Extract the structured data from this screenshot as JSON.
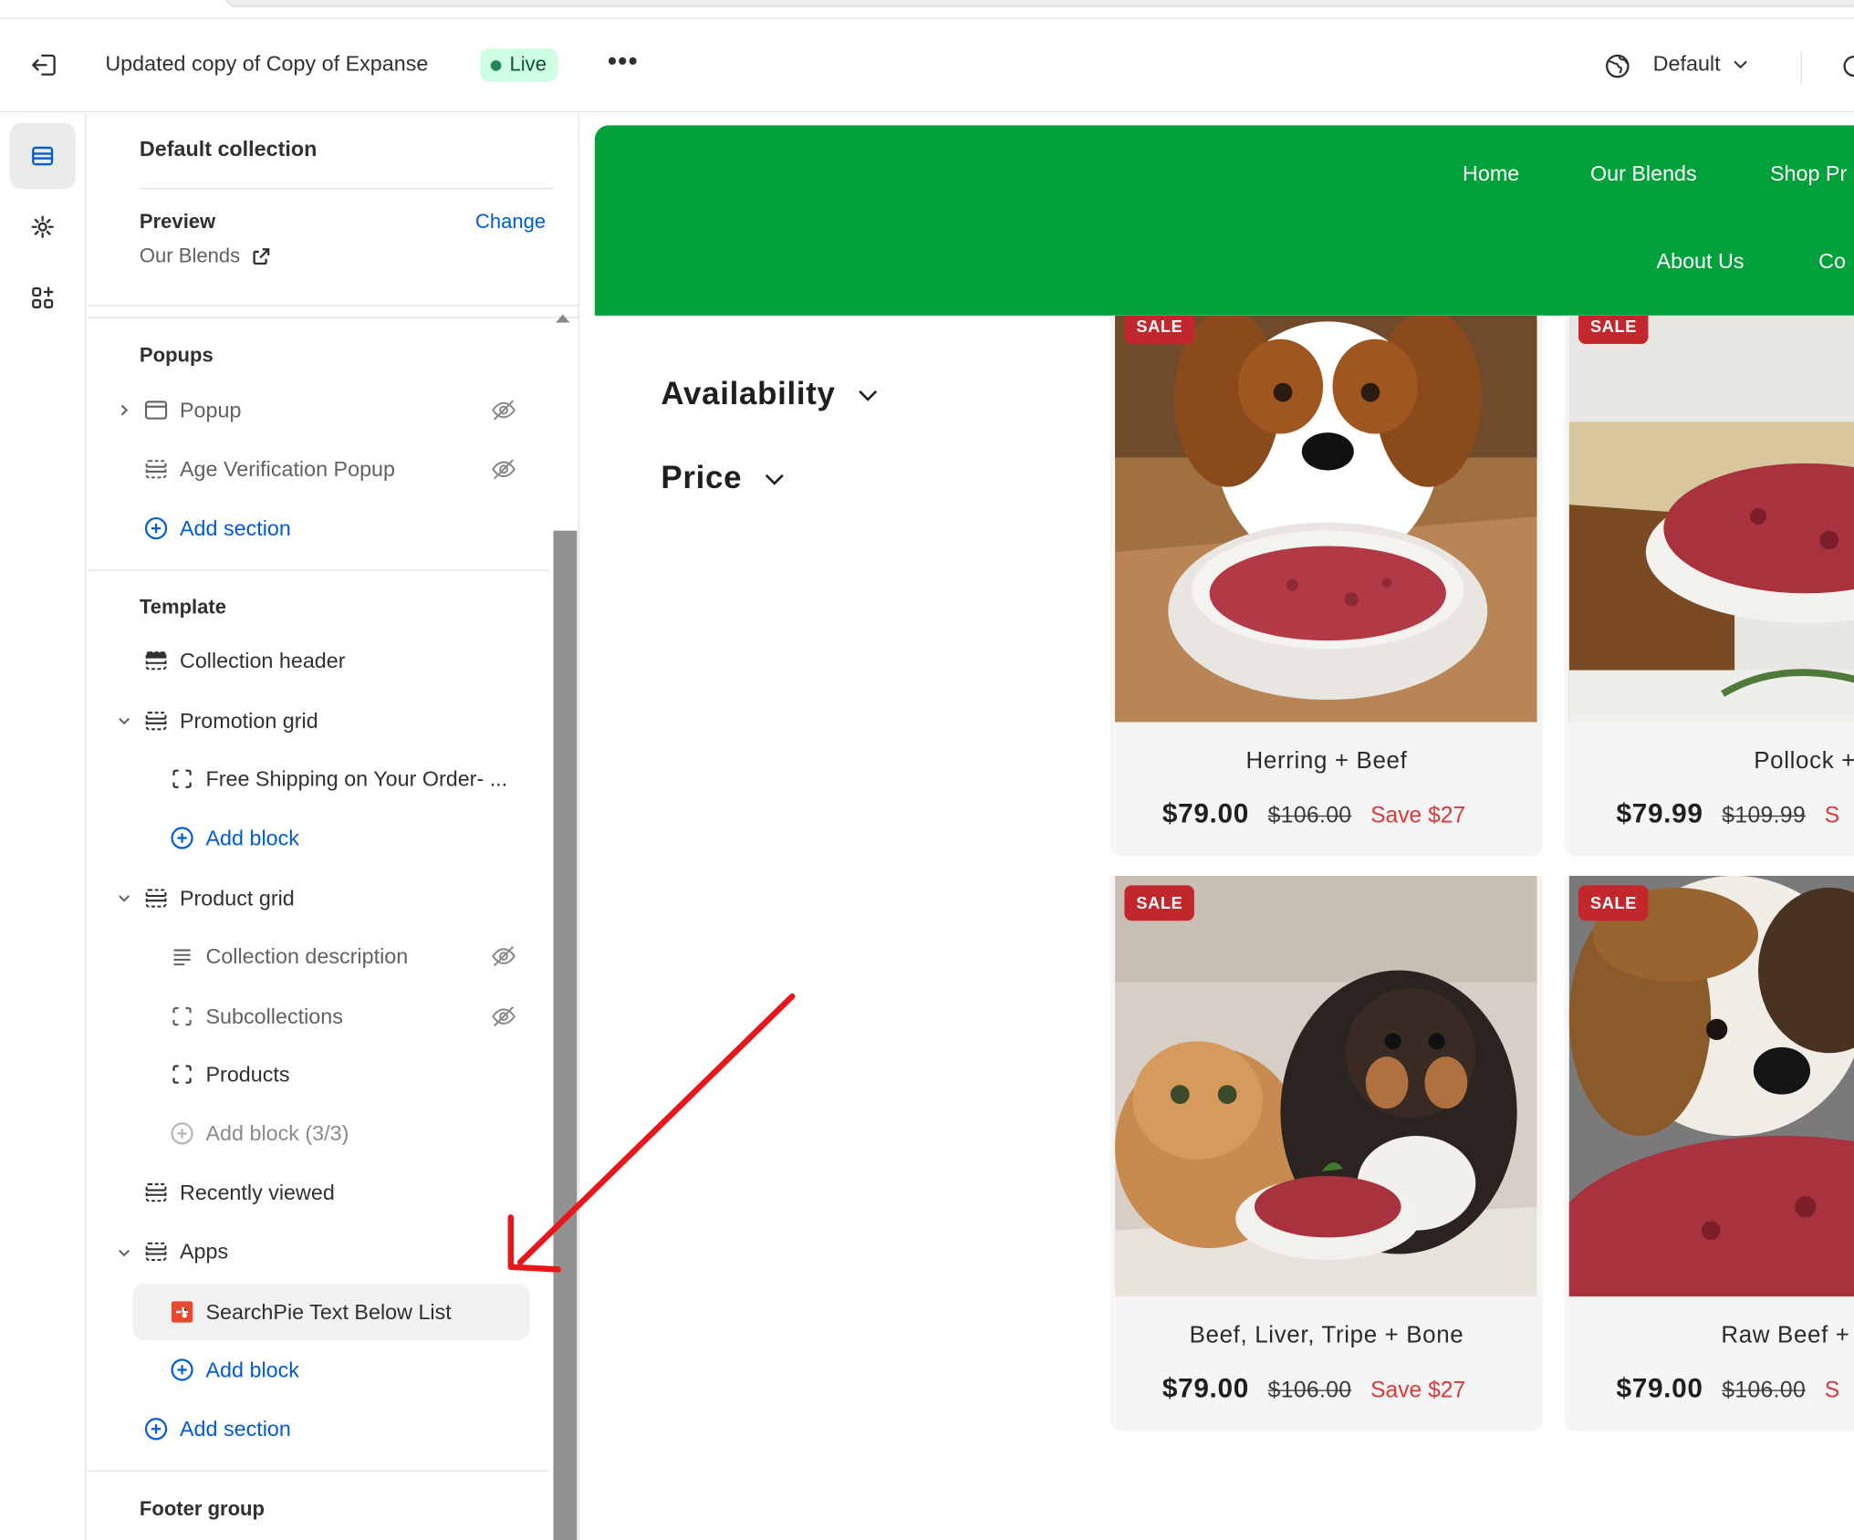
{
  "topbar": {
    "title": "Updated copy of Copy of Expanse",
    "status": "Live",
    "more": "•••",
    "locale": "Default"
  },
  "sidebar": {
    "title": "Default collection",
    "preview_label": "Preview",
    "preview_value": "Our Blends",
    "change_label": "Change",
    "popups": {
      "heading": "Popups",
      "items": [
        "Popup",
        "Age Verification Popup"
      ],
      "add_section": "Add section"
    },
    "template": {
      "heading": "Template",
      "collection_header": "Collection header",
      "promotion_grid": "Promotion grid",
      "promotion_block": "Free Shipping on Your Order- ...",
      "add_block": "Add block",
      "product_grid": "Product grid",
      "product_blocks": [
        "Collection description",
        "Subcollections",
        "Products"
      ],
      "add_block_disabled": "Add block (3/3)",
      "recently_viewed": "Recently viewed",
      "apps": "Apps",
      "app_block": "SearchPie Text Below List",
      "apps_add_block": "Add block",
      "add_section": "Add section"
    },
    "footer_group": "Footer group"
  },
  "store": {
    "brand_color": "#00a03b",
    "nav": [
      "Home",
      "Our Blends",
      "Shop Pr",
      "About Us",
      "Co"
    ],
    "facets": [
      "Availability",
      "Price"
    ],
    "sale_badge": "SALE",
    "products": [
      {
        "title": "Herring + Beef",
        "price": "$79.00",
        "compare": "$106.00",
        "save": "Save $27"
      },
      {
        "title": "Pollock + Bee",
        "price": "$79.99",
        "compare": "$109.99",
        "save": "S"
      },
      {
        "title": "Beef, Liver, Tripe + Bone",
        "price": "$79.00",
        "compare": "$106.00",
        "save": "Save $27"
      },
      {
        "title": "Raw Beef + Ground",
        "price": "$79.00",
        "compare": "$106.00",
        "save": "S"
      }
    ]
  }
}
